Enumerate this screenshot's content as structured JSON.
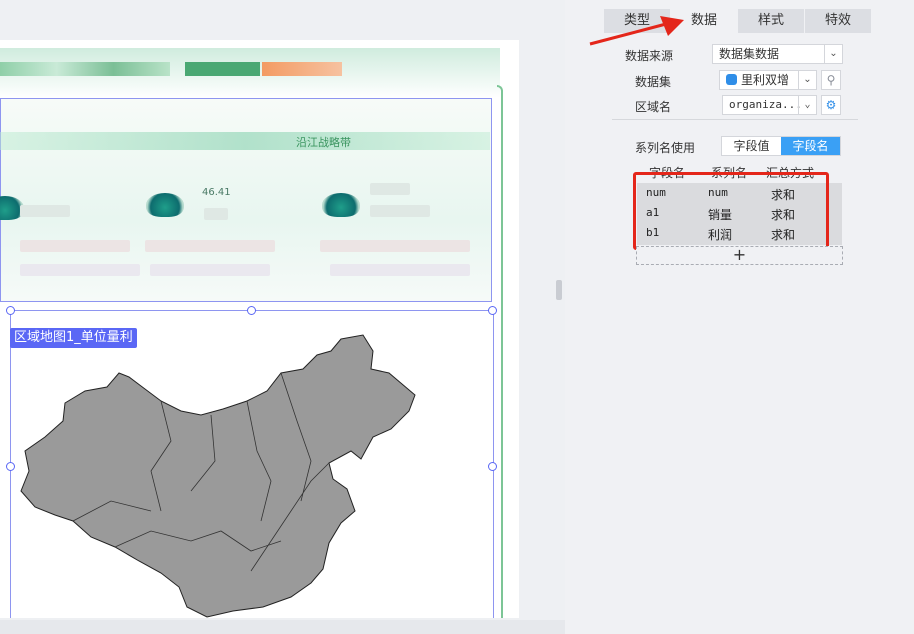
{
  "canvas": {
    "section_header": "沿江战略带",
    "metric_value": "46.41",
    "map_label": "区域地图1_单位量利"
  },
  "tabs": [
    {
      "label": "类型",
      "active": false
    },
    {
      "label": "数据",
      "active": true
    },
    {
      "label": "样式",
      "active": false
    },
    {
      "label": "特效",
      "active": false
    }
  ],
  "form": {
    "source_label": "数据来源",
    "source_value": "数据集数据",
    "dataset_label": "数据集",
    "dataset_value": "里利双增",
    "region_label": "区域名",
    "region_value": "organiza..."
  },
  "series_usage": {
    "label": "系列名使用",
    "options": [
      "字段值",
      "字段名"
    ],
    "selected": "字段名"
  },
  "field_table": {
    "headers": [
      "字段名",
      "系列名",
      "汇总方式"
    ],
    "rows": [
      {
        "field": "num",
        "series": "num",
        "agg": "求和"
      },
      {
        "field": "a1",
        "series": "销量",
        "agg": "求和"
      },
      {
        "field": "b1",
        "series": "利润",
        "agg": "求和"
      }
    ],
    "add_label": "+"
  },
  "colors": {
    "accent": "#3aa0f5",
    "highlight": "#e4261a",
    "selection": "#5a67f5",
    "map_fill": "#999999"
  }
}
